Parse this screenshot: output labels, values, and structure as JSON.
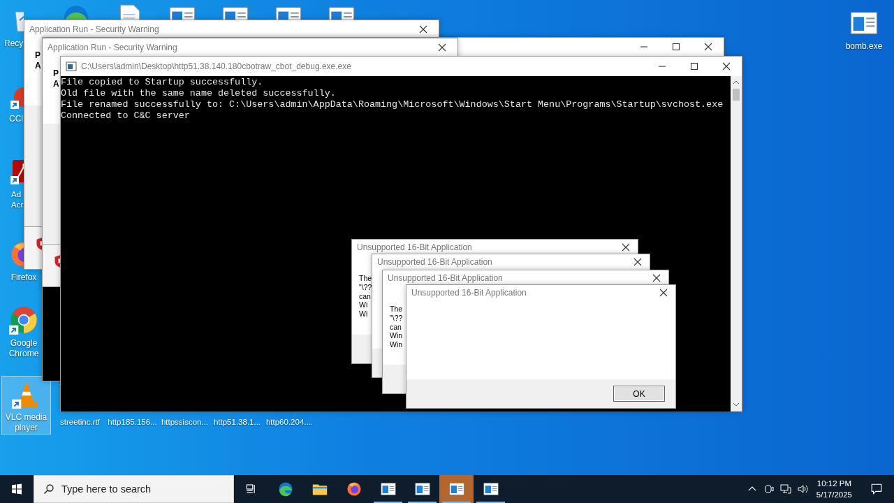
{
  "desktop_icons": [
    {
      "kind": "recycle",
      "label": "Recy",
      "selected": false
    },
    {
      "kind": "ccleaner",
      "label": "CCl",
      "selected": false
    },
    {
      "kind": "acrobat",
      "label": "Ad Acr",
      "selected": false
    },
    {
      "kind": "firefox",
      "label": "Firefox",
      "selected": false
    },
    {
      "kind": "chrome",
      "label": "Google Chrome",
      "selected": false
    },
    {
      "kind": "vlc",
      "label": "VLC media player",
      "selected": true
    }
  ],
  "top_icons": [
    {
      "kind": "edge"
    },
    {
      "kind": "document"
    },
    {
      "kind": "app"
    },
    {
      "kind": "app"
    },
    {
      "kind": "app"
    },
    {
      "kind": "app"
    }
  ],
  "right_icons": [
    {
      "kind": "app",
      "label": "bomb.exe"
    }
  ],
  "bottom_icons": [
    {
      "label": "streetinc.rtf"
    },
    {
      "label": "http185.156..."
    },
    {
      "label": "httpssiscon..."
    },
    {
      "label": "http51.38.1..."
    },
    {
      "label": "http60.204...."
    }
  ],
  "security_windows": [
    {
      "title": "Application Run - Security Warning",
      "lines": [
        "P",
        "A"
      ]
    },
    {
      "title": "Application Run - Security Warning",
      "lines": [
        "P",
        "A"
      ]
    }
  ],
  "console": {
    "title": "C:\\Users\\admin\\Desktop\\http51.38.140.180cbotraw_cbot_debug.exe.exe",
    "lines": [
      "File copied to Startup successfully.",
      "Old file with the same name deleted successfully.",
      "File renamed successfully to: C:\\Users\\admin\\AppData\\Roaming\\Microsoft\\Windows\\Start Menu\\Programs\\Startup\\svchost.exe",
      "Connected to C&C server"
    ]
  },
  "dialogs": [
    {
      "title": "Unsupported 16-Bit Application",
      "lines": [
        "The",
        "\"\\??",
        "can",
        "Wi",
        "Wi"
      ]
    },
    {
      "title": "Unsupported 16-Bit Application"
    },
    {
      "title": "Unsupported 16-Bit Application",
      "lines": [
        "The",
        "\"\\??",
        "can",
        "Win",
        "Win"
      ]
    },
    {
      "title": "Unsupported 16-Bit Application",
      "button": "OK"
    }
  ],
  "taskbar": {
    "search": {
      "placeholder": "Type here to search"
    },
    "apps": [
      {
        "kind": "taskview",
        "running": false,
        "selected": false
      },
      {
        "kind": "edge",
        "running": false,
        "selected": false
      },
      {
        "kind": "folder",
        "running": false,
        "selected": false
      },
      {
        "kind": "firefox",
        "running": false,
        "selected": false
      },
      {
        "kind": "app",
        "running": true,
        "selected": false
      },
      {
        "kind": "app",
        "running": true,
        "selected": false
      },
      {
        "kind": "app",
        "running": true,
        "selected": true
      },
      {
        "kind": "app",
        "running": true,
        "selected": false
      }
    ],
    "clock": {
      "time": "10:12 PM",
      "date": "5/17/2025"
    }
  }
}
